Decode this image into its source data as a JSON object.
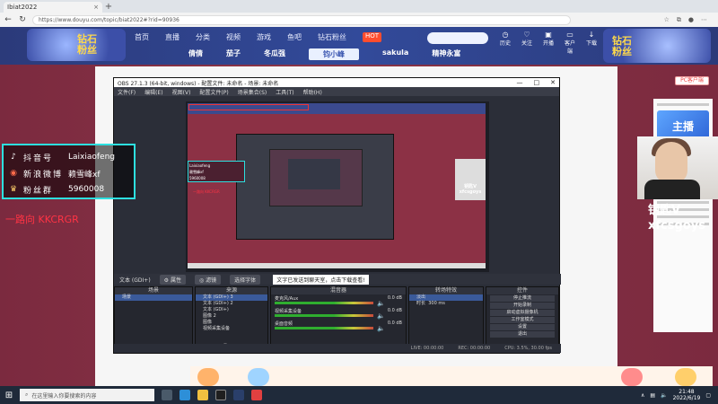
{
  "browser": {
    "tab_title": "Ibiat2022",
    "url": "https://www.douyu.com/topic/biat2022#?rid=90936"
  },
  "site": {
    "logo_text": "钻石粉丝",
    "nav": [
      "首页",
      "直播",
      "分类",
      "视频",
      "游戏",
      "鱼吧",
      "钻石粉丝"
    ],
    "nav_badge": "HOT",
    "subnav": [
      "倩倩",
      "茄子",
      "冬瓜强",
      "钧小峰",
      "sakula",
      "精神永富"
    ],
    "subnav_active": "钧小峰",
    "header_icons": [
      "历史",
      "关注",
      "开播",
      "客户端",
      "下载"
    ],
    "pc_button": "PC客户端",
    "right_banner": "主播"
  },
  "obs": {
    "title": "OBS 27.1.3 (64-bit, windows) - 配置文件: 未命名 - 场景: 未命名",
    "menu": [
      "文件(F)",
      "编辑(E)",
      "视图(V)",
      "配置文件(P)",
      "场景集合(S)",
      "工具(T)",
      "帮助(H)"
    ],
    "source_bar": {
      "current": "文本 (GDI+)",
      "properties": "属性",
      "filters": "滤镜",
      "select": "选择字体",
      "notice": "文字已发送到聊天室，点击下载查看!"
    },
    "dock_titles": [
      "场景",
      "来源",
      "混音器",
      "转场特效",
      "控件"
    ],
    "scenes": [
      "场景"
    ],
    "sources": [
      "文本 (GDI+) 3",
      "文本 (GDI+) 2",
      "文本 (GDI+)",
      "图像 2",
      "图像",
      "视频采集设备"
    ],
    "mixer": [
      {
        "name": "麦克风/Aux",
        "db": "0.0 dB"
      },
      {
        "name": "视频采集设备",
        "db": "0.0 dB"
      },
      {
        "name": "桌面音频",
        "db": "0.0 dB"
      }
    ],
    "transition": {
      "type": "淡出",
      "duration_label": "时长",
      "duration": "300 ms"
    },
    "controls": [
      "停止推流",
      "开始录制",
      "启动虚拟摄像机",
      "工作室模式",
      "设置",
      "退出"
    ],
    "status": [
      "LIVE: 00:00:00",
      "REC: 00:00:00",
      "CPU: 3.5%, 30.00 fps"
    ]
  },
  "overlay": {
    "rows": [
      {
        "icon": "tiktok-icon",
        "label": "抖音号",
        "value": "Laixiaofeng"
      },
      {
        "icon": "weibo-icon",
        "label": "新浪微博",
        "value": "赖雪峰xf"
      },
      {
        "icon": "fans-icon",
        "label": "粉丝群",
        "value": "5960008"
      }
    ],
    "red_caption": "一路向 KKCRGR",
    "cam_name_1": "钥匙V",
    "cam_name_2": "xfcsgoys"
  },
  "taskbar": {
    "search_placeholder": "在这里输入你要搜索的内容",
    "time": "21:48",
    "date": "2022/6/19"
  },
  "colors": {
    "accent": "#2de0e0",
    "brand": "#324a9a",
    "alert": "#ff3344"
  }
}
